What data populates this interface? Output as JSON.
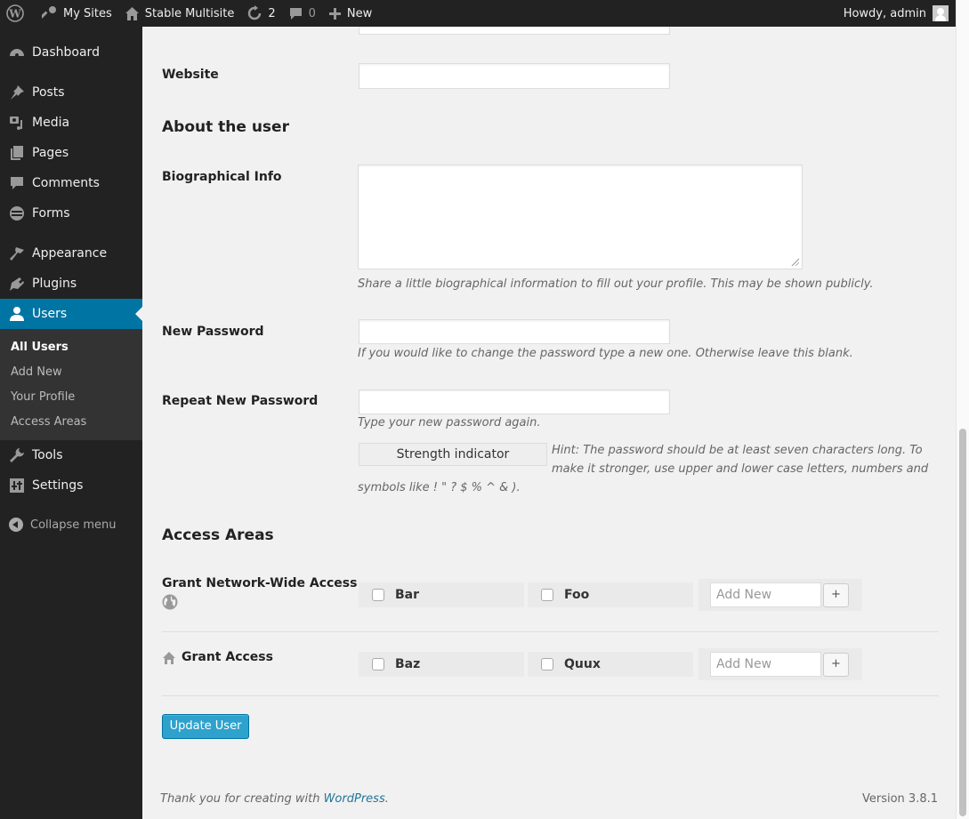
{
  "adminbar": {
    "wp_logo": "wordpress-logo-icon",
    "my_sites": "My Sites",
    "site_name": "Stable Multisite",
    "updates_count": "2",
    "comments_count": "0",
    "new_label": "New",
    "greeting": "Howdy, admin"
  },
  "sidebar": {
    "items": [
      {
        "label": "Dashboard",
        "icon": "dashboard-icon"
      },
      {
        "label": "Posts",
        "icon": "pin-icon"
      },
      {
        "label": "Media",
        "icon": "media-icon"
      },
      {
        "label": "Pages",
        "icon": "pages-icon"
      },
      {
        "label": "Comments",
        "icon": "comment-icon"
      },
      {
        "label": "Forms",
        "icon": "forms-icon"
      },
      {
        "label": "Appearance",
        "icon": "brush-icon"
      },
      {
        "label": "Plugins",
        "icon": "plug-icon"
      },
      {
        "label": "Users",
        "icon": "user-icon",
        "active": true
      },
      {
        "label": "Tools",
        "icon": "wrench-icon"
      },
      {
        "label": "Settings",
        "icon": "settings-icon"
      }
    ],
    "users_submenu": [
      "All Users",
      "Add New",
      "Your Profile",
      "Access Areas"
    ],
    "collapse_label": "Collapse menu"
  },
  "form": {
    "website_label": "Website",
    "website_value": "",
    "about_heading": "About the user",
    "bio_label": "Biographical Info",
    "bio_value": "",
    "bio_desc": "Share a little biographical information to fill out your profile. This may be shown publicly.",
    "new_password_label": "New Password",
    "new_password_desc": "If you would like to change the password type a new one. Otherwise leave this blank.",
    "repeat_password_label": "Repeat New Password",
    "repeat_password_desc": "Type your new password again.",
    "strength_indicator": "Strength indicator",
    "hint_line1": "Hint: The password should be at least seven characters long. To",
    "hint_line2": "make it stronger, use upper and lower case letters, numbers and",
    "hint_line3": "symbols like ! \" ? $ % ^ & )."
  },
  "access": {
    "heading": "Access Areas",
    "network_label": "Grant Network-Wide Access",
    "network_areas": [
      "Bar",
      "Foo"
    ],
    "grant_label": "Grant Access",
    "grant_areas": [
      "Baz",
      "Quux"
    ],
    "add_new_placeholder": "Add New",
    "add_button": "+"
  },
  "submit_label": "Update User",
  "footer": {
    "thanks_prefix": "Thank you for creating with ",
    "wordpress_link": "WordPress",
    "thanks_suffix": ".",
    "version": "Version 3.8.1"
  },
  "colors": {
    "accent": "#0074a2",
    "button": "#2ea2cc",
    "sidebar_bg": "#222222",
    "content_bg": "#f1f1f1"
  }
}
